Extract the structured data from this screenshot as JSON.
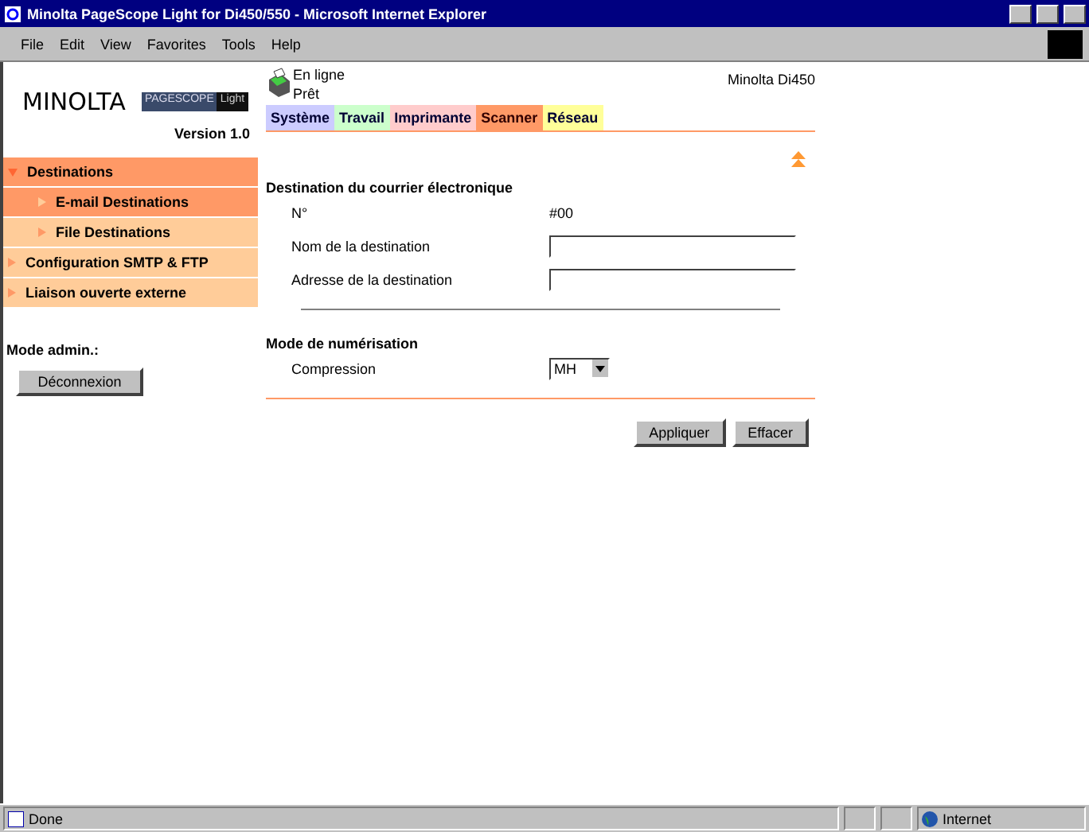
{
  "window": {
    "title": "Minolta PageScope Light for Di450/550 - Microsoft Internet Explorer"
  },
  "menu": [
    "File",
    "Edit",
    "View",
    "Favorites",
    "Tools",
    "Help"
  ],
  "logo": {
    "brand": "MINOLTA",
    "product": "PAGESCOPE",
    "product_suffix": "Light",
    "version": "Version 1.0"
  },
  "status": {
    "lines": [
      "En ligne",
      "Prêt"
    ],
    "device": "Minolta Di450"
  },
  "tabs": [
    {
      "label": "Système",
      "color": "#ccccff",
      "selected": false
    },
    {
      "label": "Travail",
      "color": "#ccffcc",
      "selected": false
    },
    {
      "label": "Imprimante",
      "color": "#ffcccc",
      "selected": false
    },
    {
      "label": "Scanner",
      "color": "#ff9966",
      "selected": true
    },
    {
      "label": "Réseau",
      "color": "#ffff99",
      "selected": false
    }
  ],
  "sidebar": {
    "items": [
      {
        "label": "Destinations",
        "expanded": true,
        "selected": true,
        "children": [
          {
            "label": "E-mail Destinations",
            "selected": true
          },
          {
            "label": "File Destinations",
            "selected": false
          }
        ]
      },
      {
        "label": "Configuration SMTP & FTP",
        "expanded": false,
        "selected": false
      },
      {
        "label": "Liaison ouverte externe",
        "expanded": false,
        "selected": false
      }
    ],
    "admin_label": "Mode admin.:",
    "logout_button": "Déconnexion"
  },
  "sections": [
    {
      "title": "Destination du courrier électronique",
      "rows": [
        {
          "kind": "text",
          "label": "N°",
          "value": "#00"
        },
        {
          "kind": "input",
          "label": "Nom de la destination"
        },
        {
          "kind": "input",
          "label": "Adresse de la destination"
        }
      ]
    },
    {
      "title": "Mode de numérisation",
      "rows": [
        {
          "kind": "select",
          "label": "Compression",
          "value": "MH"
        }
      ]
    }
  ],
  "buttons": [
    "Appliquer",
    "Effacer"
  ],
  "status_bar": {
    "text": "Done",
    "zone": "Internet"
  }
}
